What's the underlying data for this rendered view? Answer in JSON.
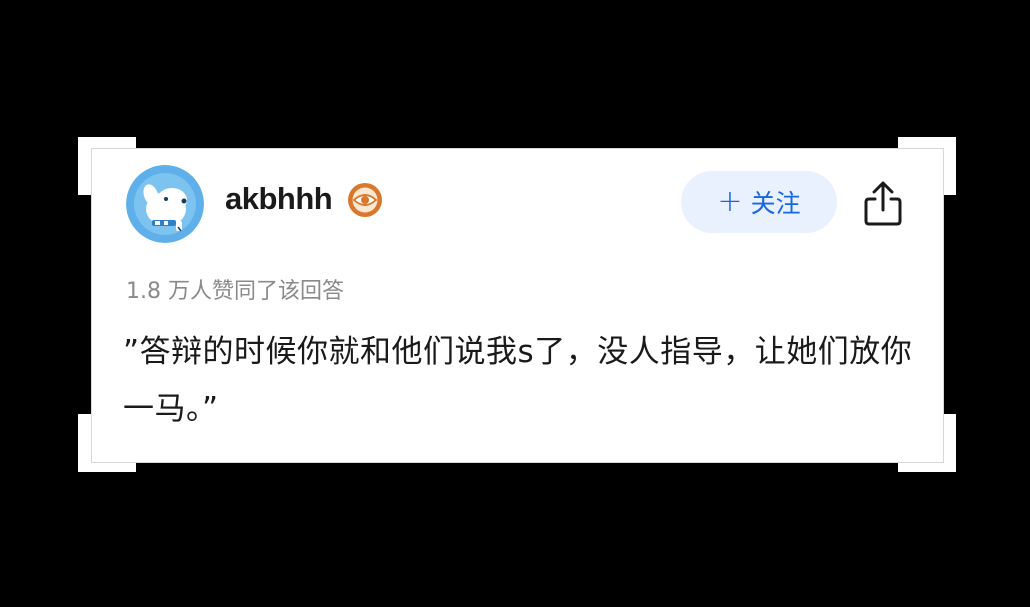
{
  "author": {
    "name": "akbhhh",
    "avatar_icon": "dog-avatar-icon",
    "badge_icon": "eye-badge-icon"
  },
  "actions": {
    "follow_plus": "+",
    "follow_label": "关注",
    "share_icon": "share-icon"
  },
  "stats": {
    "likes_text": "1.8 万人赞同了该回答"
  },
  "answer": {
    "text": "”答辩的时候你就和他们说我s了，没人指导，让她们放你一马。”"
  },
  "colors": {
    "background": "#000000",
    "card": "#ffffff",
    "accent": "#1966e3",
    "follow_bg": "#e8f1fd",
    "avatar_bg": "#5fb0ea",
    "badge": "#d9782c",
    "muted_text": "#8a8a8a"
  }
}
